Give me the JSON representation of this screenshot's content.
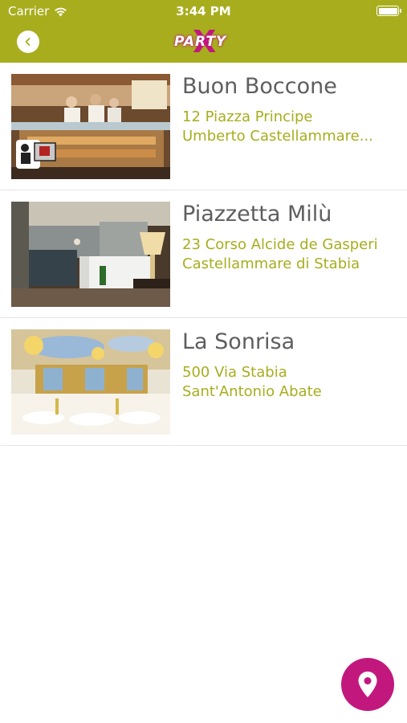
{
  "status_bar": {
    "carrier": "Carrier",
    "time": "3:44 PM"
  },
  "header": {
    "logo_text": "PARTY",
    "logo_mark": "X",
    "back_icon": "chevron-left-icon"
  },
  "colors": {
    "brand_olive": "#a8ad1e",
    "brand_magenta": "#c2187e",
    "title_gray": "#5e5e5e"
  },
  "venues": [
    {
      "name": "Buon Boccone",
      "address_line1": "12 Piazza Principe",
      "address_line2": "Umberto Castellammare..."
    },
    {
      "name": "Piazzetta Milù",
      "address_line1": "23 Corso Alcide de Gasperi",
      "address_line2": "Castellammare di Stabia"
    },
    {
      "name": "La Sonrisa",
      "address_line1": "500 Via Stabia",
      "address_line2": "Sant'Antonio Abate"
    }
  ],
  "fab": {
    "icon": "map-pin-icon"
  }
}
